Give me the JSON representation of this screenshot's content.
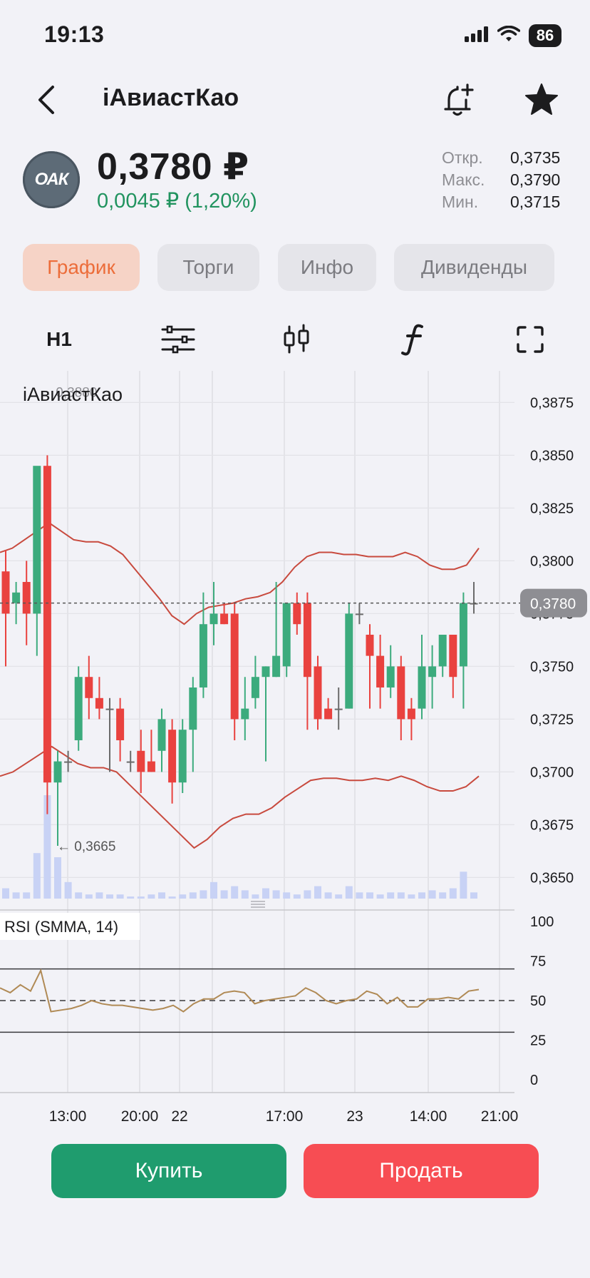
{
  "status_bar": {
    "time": "19:13",
    "battery": "86"
  },
  "header": {
    "title": "iАвиастКао"
  },
  "quote": {
    "logo_text": "ОАК",
    "price": "0,3780 ₽",
    "change": "0,0045 ₽ (1,20%)",
    "stats": [
      {
        "label": "Откр.",
        "value": "0,3735"
      },
      {
        "label": "Макс.",
        "value": "0,3790"
      },
      {
        "label": "Мин.",
        "value": "0,3715"
      }
    ]
  },
  "tabs": [
    {
      "label": "График",
      "active": true
    },
    {
      "label": "Торги",
      "active": false
    },
    {
      "label": "Инфо",
      "active": false
    },
    {
      "label": "Дивиденды",
      "active": false
    }
  ],
  "toolbar": {
    "timeframe": "H1",
    "icons": [
      "settings-sliders-icon",
      "candlestick-icon",
      "function-icon",
      "fullscreen-icon"
    ]
  },
  "colors": {
    "up": "#3cab7d",
    "down": "#e9423f",
    "bands": "#c84a3e",
    "rsi": "#b08a55",
    "volume": "#c8d2f5",
    "buy": "#1f9c6e",
    "sell": "#f74d53",
    "accent": "#ec6d3a"
  },
  "chart_data": {
    "type": "candlestick",
    "title": "iАвиастКао",
    "price_axis": {
      "ticks": [
        "0,3875",
        "0,3850",
        "0,3825",
        "0,3800",
        "0,3775",
        "0,3750",
        "0,3725",
        "0,3700",
        "0,3675",
        "0,3650"
      ],
      "ylim": [
        0.364,
        0.389
      ]
    },
    "x_tick_labels": [
      "13:00",
      "20:00",
      "22",
      "17:00",
      "23",
      "14:00",
      "21:00"
    ],
    "current_price_label": "0,3780",
    "high_marker": "← 0,3880",
    "low_marker": "← 0,3665",
    "candles": [
      {
        "o": 0.3795,
        "h": 0.3805,
        "l": 0.375,
        "c": 0.3775
      },
      {
        "o": 0.378,
        "h": 0.379,
        "l": 0.377,
        "c": 0.3785
      },
      {
        "o": 0.379,
        "h": 0.38,
        "l": 0.376,
        "c": 0.3775
      },
      {
        "o": 0.3775,
        "h": 0.383,
        "l": 0.3755,
        "c": 0.3845
      },
      {
        "o": 0.3845,
        "h": 0.385,
        "l": 0.368,
        "c": 0.3695
      },
      {
        "o": 0.3695,
        "h": 0.371,
        "l": 0.3665,
        "c": 0.3705
      },
      {
        "o": 0.3705,
        "h": 0.371,
        "l": 0.37,
        "c": 0.3705
      },
      {
        "o": 0.3715,
        "h": 0.375,
        "l": 0.371,
        "c": 0.3745
      },
      {
        "o": 0.3745,
        "h": 0.3755,
        "l": 0.3725,
        "c": 0.3735
      },
      {
        "o": 0.3735,
        "h": 0.3745,
        "l": 0.3725,
        "c": 0.373
      },
      {
        "o": 0.373,
        "h": 0.3735,
        "l": 0.37,
        "c": 0.373
      },
      {
        "o": 0.373,
        "h": 0.3735,
        "l": 0.3705,
        "c": 0.3715
      },
      {
        "o": 0.3705,
        "h": 0.371,
        "l": 0.37,
        "c": 0.3705
      },
      {
        "o": 0.371,
        "h": 0.372,
        "l": 0.369,
        "c": 0.37
      },
      {
        "o": 0.3705,
        "h": 0.372,
        "l": 0.37,
        "c": 0.37
      },
      {
        "o": 0.371,
        "h": 0.373,
        "l": 0.37,
        "c": 0.3725
      },
      {
        "o": 0.372,
        "h": 0.3725,
        "l": 0.3685,
        "c": 0.3695
      },
      {
        "o": 0.3695,
        "h": 0.3725,
        "l": 0.369,
        "c": 0.372
      },
      {
        "o": 0.372,
        "h": 0.3745,
        "l": 0.37,
        "c": 0.374
      },
      {
        "o": 0.374,
        "h": 0.3785,
        "l": 0.3735,
        "c": 0.377
      },
      {
        "o": 0.377,
        "h": 0.379,
        "l": 0.376,
        "c": 0.3775
      },
      {
        "o": 0.3775,
        "h": 0.378,
        "l": 0.377,
        "c": 0.377
      },
      {
        "o": 0.3775,
        "h": 0.378,
        "l": 0.3715,
        "c": 0.3725
      },
      {
        "o": 0.3725,
        "h": 0.3745,
        "l": 0.3715,
        "c": 0.373
      },
      {
        "o": 0.3735,
        "h": 0.3755,
        "l": 0.373,
        "c": 0.3745
      },
      {
        "o": 0.3745,
        "h": 0.375,
        "l": 0.3705,
        "c": 0.375
      },
      {
        "o": 0.3745,
        "h": 0.379,
        "l": 0.3745,
        "c": 0.3755
      },
      {
        "o": 0.375,
        "h": 0.378,
        "l": 0.3745,
        "c": 0.378
      },
      {
        "o": 0.378,
        "h": 0.3785,
        "l": 0.3765,
        "c": 0.377
      },
      {
        "o": 0.378,
        "h": 0.3785,
        "l": 0.372,
        "c": 0.3745
      },
      {
        "o": 0.375,
        "h": 0.3755,
        "l": 0.372,
        "c": 0.3725
      },
      {
        "o": 0.373,
        "h": 0.3735,
        "l": 0.3725,
        "c": 0.3725
      },
      {
        "o": 0.373,
        "h": 0.374,
        "l": 0.372,
        "c": 0.373
      },
      {
        "o": 0.373,
        "h": 0.378,
        "l": 0.373,
        "c": 0.3775
      },
      {
        "o": 0.3775,
        "h": 0.378,
        "l": 0.377,
        "c": 0.3775
      },
      {
        "o": 0.3765,
        "h": 0.377,
        "l": 0.373,
        "c": 0.3755
      },
      {
        "o": 0.3755,
        "h": 0.3765,
        "l": 0.373,
        "c": 0.374
      },
      {
        "o": 0.374,
        "h": 0.376,
        "l": 0.3735,
        "c": 0.375
      },
      {
        "o": 0.375,
        "h": 0.3755,
        "l": 0.3715,
        "c": 0.3725
      },
      {
        "o": 0.373,
        "h": 0.3735,
        "l": 0.3715,
        "c": 0.3725
      },
      {
        "o": 0.373,
        "h": 0.3765,
        "l": 0.3725,
        "c": 0.375
      },
      {
        "o": 0.3745,
        "h": 0.376,
        "l": 0.373,
        "c": 0.375
      },
      {
        "o": 0.375,
        "h": 0.376,
        "l": 0.3745,
        "c": 0.3765
      },
      {
        "o": 0.3765,
        "h": 0.3765,
        "l": 0.3735,
        "c": 0.3745
      },
      {
        "o": 0.375,
        "h": 0.3785,
        "l": 0.373,
        "c": 0.378
      },
      {
        "o": 0.378,
        "h": 0.379,
        "l": 0.3775,
        "c": 0.378
      }
    ],
    "volume": [
      0.5,
      0.3,
      0.3,
      2.2,
      5.0,
      2.0,
      0.8,
      0.3,
      0.2,
      0.3,
      0.2,
      0.2,
      0.1,
      0.1,
      0.2,
      0.3,
      0.1,
      0.2,
      0.3,
      0.4,
      0.8,
      0.4,
      0.6,
      0.4,
      0.2,
      0.5,
      0.4,
      0.3,
      0.2,
      0.4,
      0.6,
      0.3,
      0.2,
      0.6,
      0.3,
      0.3,
      0.2,
      0.3,
      0.3,
      0.2,
      0.3,
      0.4,
      0.3,
      0.5,
      1.3,
      0.3
    ],
    "bollinger": {
      "upper": [
        0.3804,
        0.3806,
        0.381,
        0.3814,
        0.3818,
        0.3814,
        0.381,
        0.3809,
        0.3809,
        0.3807,
        0.3803,
        0.3796,
        0.3789,
        0.3782,
        0.3774,
        0.377,
        0.3775,
        0.3778,
        0.3779,
        0.378,
        0.3782,
        0.3783,
        0.3785,
        0.379,
        0.3797,
        0.3802,
        0.3804,
        0.3804,
        0.3803,
        0.3803,
        0.3802,
        0.3802,
        0.3802,
        0.3804,
        0.3802,
        0.3798,
        0.3796,
        0.3796,
        0.3798,
        0.3806
      ],
      "lower": [
        0.3698,
        0.37,
        0.3704,
        0.3708,
        0.3712,
        0.3708,
        0.3704,
        0.3702,
        0.3702,
        0.37,
        0.3694,
        0.3688,
        0.3682,
        0.3676,
        0.367,
        0.3664,
        0.3668,
        0.3674,
        0.3678,
        0.368,
        0.368,
        0.3683,
        0.3688,
        0.3692,
        0.3696,
        0.3697,
        0.3697,
        0.3696,
        0.3696,
        0.3697,
        0.3696,
        0.3698,
        0.3696,
        0.3693,
        0.3691,
        0.3691,
        0.3693,
        0.3698
      ]
    },
    "rsi": {
      "label": "RSI (SMMA, 14)",
      "ticks": [
        "100",
        "75",
        "50",
        "25",
        "0"
      ],
      "levels": [
        30,
        50,
        70
      ],
      "values": [
        58,
        55,
        60,
        56,
        69,
        43,
        44,
        45,
        47,
        50,
        48,
        47,
        47,
        46,
        45,
        44,
        45,
        47,
        43,
        48,
        51,
        51,
        55,
        56,
        55,
        48,
        50,
        51,
        52,
        53,
        58,
        55,
        50,
        48,
        50,
        51,
        56,
        54,
        48,
        52,
        46,
        46,
        51,
        51,
        52,
        51,
        56,
        57
      ]
    }
  },
  "actions": {
    "buy": "Купить",
    "sell": "Продать"
  }
}
